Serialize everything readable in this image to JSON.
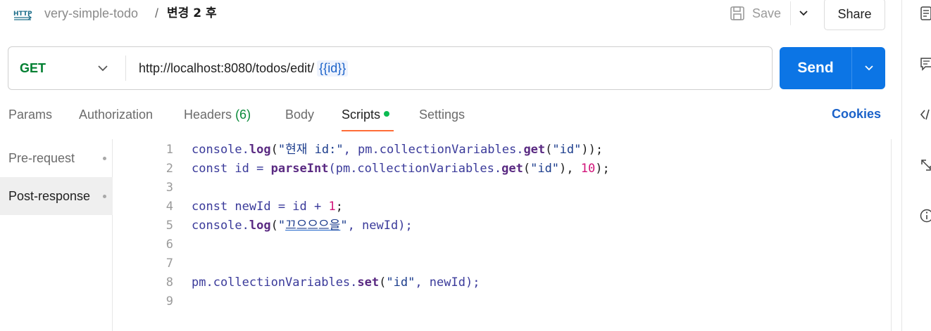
{
  "header": {
    "collection": "very-simple-todo",
    "separator": "/",
    "request_name": "변경 2 후",
    "save_label": "Save",
    "share_label": "Share",
    "http_icon": "http-request-icon"
  },
  "request": {
    "method": "GET",
    "url_base": "http://localhost:8080/todos/edit/",
    "url_variable": "{{id}}",
    "send_label": "Send"
  },
  "tabs": {
    "params": "Params",
    "authorization": "Authorization",
    "headers": "Headers",
    "headers_count": "(6)",
    "body": "Body",
    "scripts": "Scripts",
    "settings": "Settings",
    "cookies": "Cookies"
  },
  "scripts_nav": {
    "pre_request": "Pre-request",
    "post_response": "Post-response"
  },
  "code": {
    "line_numbers": [
      "1",
      "2",
      "3",
      "4",
      "5",
      "6",
      "7",
      "8",
      "9"
    ],
    "l1": [
      "console.",
      "log",
      "(",
      "\"현재 id:\"",
      ", pm.collectionVariables.",
      "get",
      "(",
      "\"id\"",
      "));"
    ],
    "l2": [
      "const id = ",
      "parseInt",
      "(pm.collectionVariables.",
      "get",
      "(",
      "\"id\"",
      "), ",
      "10",
      ");"
    ],
    "l4": [
      "const newId = id + ",
      "1",
      ";"
    ],
    "l5": [
      "console.",
      "log",
      "(",
      "\"",
      "끄으으으을",
      "\"",
      ", newId);"
    ],
    "l8": [
      "pm.collectionVariables.",
      "set",
      "(",
      "\"id\"",
      ", newId);"
    ]
  },
  "colors": {
    "send": "#0c75e5",
    "method_get": "#007f31",
    "active_tab_underline": "#ff6c37",
    "scripts_dot": "#0cbb52",
    "cookies_link": "#1b62c9"
  },
  "right_rail_icons": [
    "documentation-icon",
    "comments-icon",
    "code-icon",
    "related-requests-icon",
    "info-icon"
  ]
}
